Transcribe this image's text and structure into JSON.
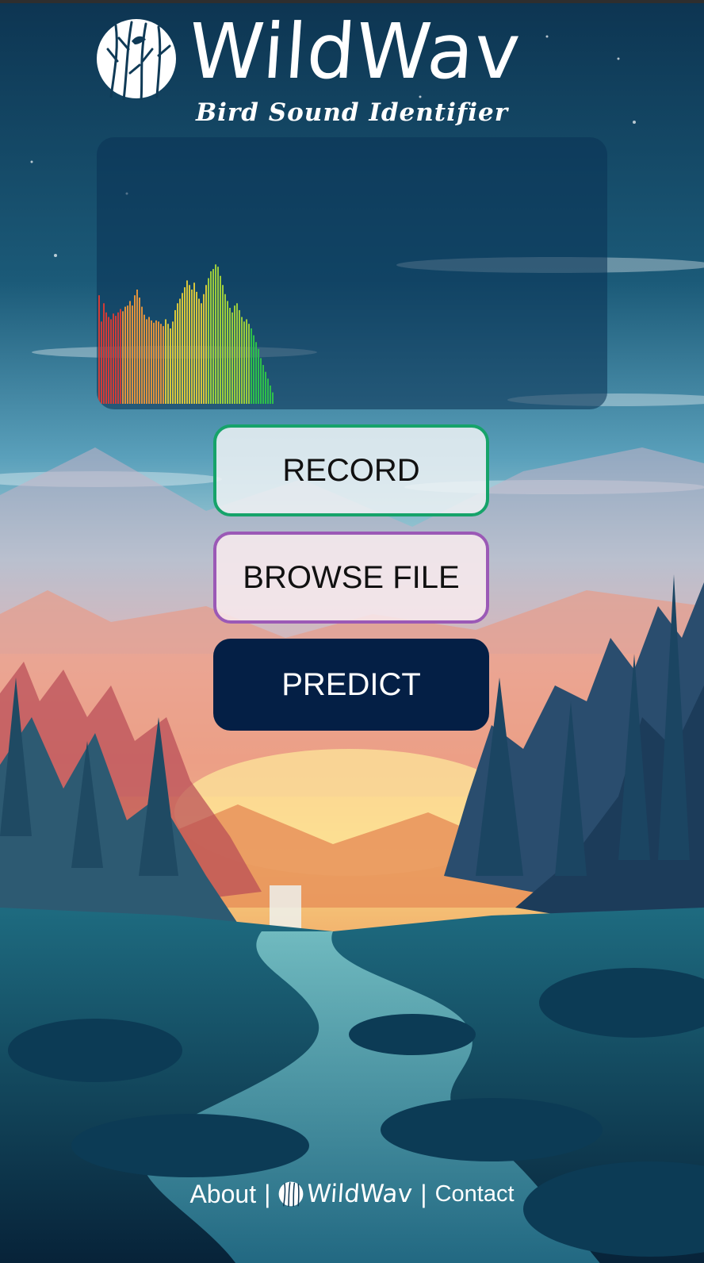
{
  "brand": {
    "name": "WildWav",
    "tagline": "Bird Sound Identifier"
  },
  "visualizer": {
    "levels": [
      0.95,
      0.72,
      0.88,
      0.8,
      0.76,
      0.74,
      0.79,
      0.77,
      0.8,
      0.83,
      0.81,
      0.85,
      0.86,
      0.9,
      0.86,
      0.95,
      1.0,
      0.93,
      0.85,
      0.78,
      0.74,
      0.76,
      0.73,
      0.71,
      0.73,
      0.72,
      0.7,
      0.68,
      0.74,
      0.7,
      0.66,
      0.72,
      0.82,
      0.88,
      0.92,
      0.97,
      1.02,
      1.08,
      1.04,
      1.0,
      1.06,
      0.98,
      0.92,
      0.88,
      0.96,
      1.04,
      1.1,
      1.16,
      1.18,
      1.22,
      1.2,
      1.12,
      1.04,
      0.96,
      0.9,
      0.84,
      0.8,
      0.86,
      0.88,
      0.82,
      0.76,
      0.72,
      0.74,
      0.7,
      0.66,
      0.6,
      0.54,
      0.48,
      0.4,
      0.34,
      0.28,
      0.22,
      0.16,
      0.1
    ],
    "max_level": 1.25,
    "gradient": [
      "#d23c36",
      "#e0923c",
      "#d7c53c",
      "#9ccc3c",
      "#2ebf4a"
    ]
  },
  "buttons": {
    "record": "RECORD",
    "browse": "BROWSE FILE",
    "predict": "PREDICT"
  },
  "footer": {
    "about": "About",
    "separator": "|",
    "logo_text": "WildWav",
    "contact": "Contact"
  },
  "colors": {
    "record_border": "#16a36a",
    "browse_border": "#9b59b6",
    "predict_bg": "#041f45"
  }
}
